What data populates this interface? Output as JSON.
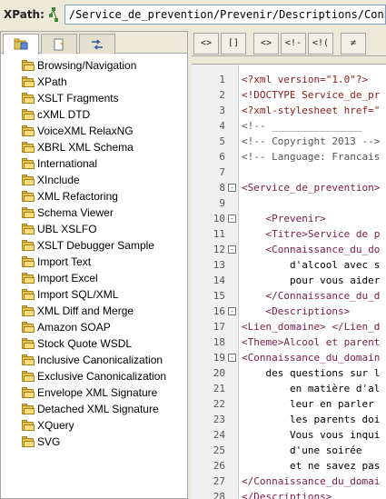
{
  "xpath": {
    "label": "XPath:",
    "value": "/Service_de_prevention/Prevenir/Descriptions/Connaissance_du_domaine"
  },
  "left_panel": {
    "tabs": [
      "project-tab",
      "outline-tab",
      "transform-tab"
    ],
    "items": [
      "Browsing/Navigation",
      "XPath",
      "XSLT Fragments",
      "cXML DTD",
      "VoiceXML RelaxNG",
      "XBRL XML Schema",
      "International",
      "XInclude",
      "XML Refactoring",
      "Schema Viewer",
      "UBL XSLFO",
      "XSLT Debugger Sample",
      "Import Text",
      "Import Excel",
      "Import SQL/XML",
      "XML Diff and Merge",
      "Amazon SOAP",
      "Stock Quote WSDL",
      "Inclusive Canonicalization",
      "Exclusive Canonicalization",
      "Envelope XML Signature",
      "Detached XML Signature",
      "XQuery",
      "SVG"
    ]
  },
  "toolbar": {
    "btn1": "<>",
    "btn2": "[]",
    "btn3": "<>",
    "btn4": "<!-",
    "btn5": "<!(",
    "btn6": "≠"
  },
  "editor": {
    "lines": [
      {
        "n": "1",
        "fold": "",
        "text": "<?xml version=\"1.0\"?>",
        "cls": "pi"
      },
      {
        "n": "2",
        "fold": "",
        "text": "<!DOCTYPE Service_de_pr",
        "cls": "pi"
      },
      {
        "n": "3",
        "fold": "",
        "text": "<?xml-stylesheet href=\"",
        "cls": "pi"
      },
      {
        "n": "4",
        "fold": "",
        "text": "<!-- _______________",
        "cls": "cmt"
      },
      {
        "n": "5",
        "fold": "",
        "text": "<!-- Copyright 2013 -->",
        "cls": "cmt"
      },
      {
        "n": "6",
        "fold": "",
        "text": "<!-- Language: Francais",
        "cls": "cmt"
      },
      {
        "n": "7",
        "fold": "",
        "text": "",
        "cls": "txt"
      },
      {
        "n": "8",
        "fold": "-",
        "text": "<Service_de_prevention>",
        "cls": "tag"
      },
      {
        "n": "9",
        "fold": "",
        "text": "",
        "cls": "txt"
      },
      {
        "n": "10",
        "fold": "-",
        "text": "    <Prevenir>",
        "cls": "tag"
      },
      {
        "n": "11",
        "fold": "",
        "text": "    <Titre>Service de p",
        "cls": "tag"
      },
      {
        "n": "12",
        "fold": "-",
        "text": "    <Connaissance_du_do",
        "cls": "tag"
      },
      {
        "n": "13",
        "fold": "",
        "text": "        d'alcool avec s",
        "cls": "txt"
      },
      {
        "n": "14",
        "fold": "",
        "text": "        pour vous aider",
        "cls": "txt"
      },
      {
        "n": "15",
        "fold": "",
        "text": "    </Connaissance_du_d",
        "cls": "tag"
      },
      {
        "n": "16",
        "fold": "-",
        "text": "    <Descriptions>",
        "cls": "tag"
      },
      {
        "n": "17",
        "fold": "",
        "text": "<Lien_domaine> </Lien_d",
        "cls": "tag"
      },
      {
        "n": "18",
        "fold": "",
        "text": "<Theme>Alcool et parent",
        "cls": "tag"
      },
      {
        "n": "19",
        "fold": "-",
        "text": "<Connaissance_du_domain",
        "cls": "tag"
      },
      {
        "n": "20",
        "fold": "",
        "text": "    des questions sur l",
        "cls": "txt"
      },
      {
        "n": "21",
        "fold": "",
        "text": "        en matière d'al",
        "cls": "txt"
      },
      {
        "n": "22",
        "fold": "",
        "text": "        leur en parler",
        "cls": "txt"
      },
      {
        "n": "23",
        "fold": "",
        "text": "        les parents doi",
        "cls": "txt"
      },
      {
        "n": "24",
        "fold": "",
        "text": "        Vous vous inqui",
        "cls": "txt"
      },
      {
        "n": "25",
        "fold": "",
        "text": "        d'une soirée",
        "cls": "txt"
      },
      {
        "n": "26",
        "fold": "",
        "text": "        et ne savez pas",
        "cls": "txt"
      },
      {
        "n": "27",
        "fold": "",
        "text": "</Connaissance_du_domai",
        "cls": "tag"
      },
      {
        "n": "28",
        "fold": "",
        "text": "</Descriptions>",
        "cls": "tag"
      }
    ]
  }
}
